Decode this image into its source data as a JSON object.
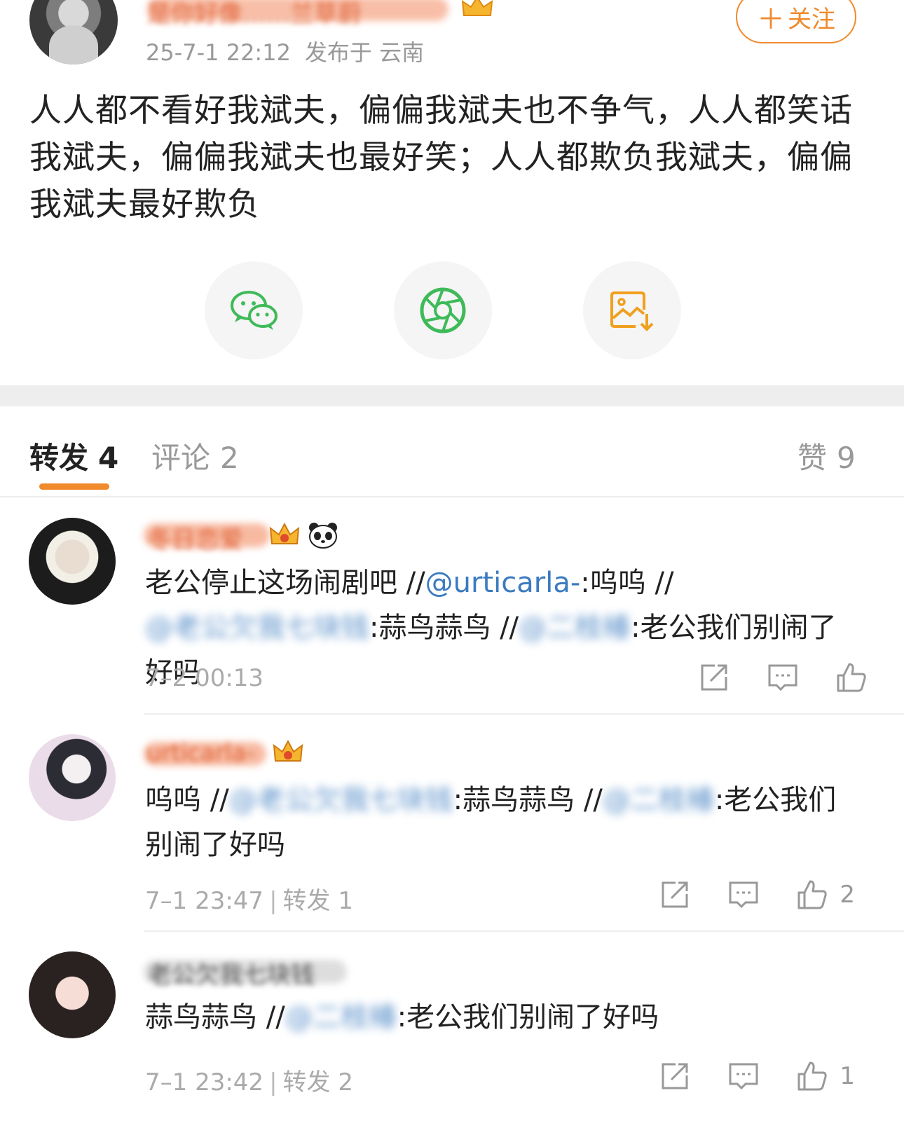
{
  "post": {
    "author_name": "是你好像……兰草蔚",
    "time": "25-7-1 22:12",
    "location": "发布于 云南",
    "follow_label": "关注",
    "body": "人人都不看好我斌夫，偏偏我斌夫也不争气，人人都笑话我斌夫，偏偏我斌夫也最好笑；人人都欺负我斌夫，偏偏我斌夫最好欺负"
  },
  "share": [
    {
      "icon": "wechat-icon",
      "color": "#3fba5a"
    },
    {
      "icon": "moments-icon",
      "color": "#3fba5a"
    },
    {
      "icon": "save-image-icon",
      "color": "#f0a020"
    }
  ],
  "tabs": {
    "forward_label": "转发",
    "forward_count": "4",
    "comment_label": "评论",
    "comment_count": "2",
    "like_label": "赞",
    "like_count": "9"
  },
  "reposts": [
    {
      "name": "冬日恋爱",
      "segments": [
        {
          "text": "老公停止这场闹剧吧 //"
        },
        {
          "mention": "@urticarla-"
        },
        {
          "text": ":呜呜 //"
        },
        {
          "mention": "@老公欠我七块钱"
        },
        {
          "text": ":蒜鸟蒜鸟 //"
        },
        {
          "mention": "@二枝椿"
        },
        {
          "text": ":老公我们别闹了好吗"
        }
      ],
      "time": "7–2 00:13",
      "forward_info": "",
      "like_count": ""
    },
    {
      "name": "urticarla-",
      "segments": [
        {
          "text": "呜呜 //"
        },
        {
          "mention": "@老公欠我七块钱"
        },
        {
          "text": ":蒜鸟蒜鸟 //"
        },
        {
          "mention": "@二枝椿"
        },
        {
          "text": ":老公我们别闹了好吗"
        }
      ],
      "time": "7–1 23:47",
      "forward_info": "转发 1",
      "like_count": "2"
    },
    {
      "name": "老公欠我七块钱",
      "segments": [
        {
          "text": "蒜鸟蒜鸟 //"
        },
        {
          "mention": "@二枝椿"
        },
        {
          "text": ":老公我们别闹了好吗"
        }
      ],
      "time": "7–1 23:42",
      "forward_info": "转发 2",
      "like_count": "1"
    }
  ],
  "colors": {
    "accent": "#f08a2c",
    "mention": "#3b7bc0",
    "muted": "#999999",
    "text": "#222222"
  }
}
